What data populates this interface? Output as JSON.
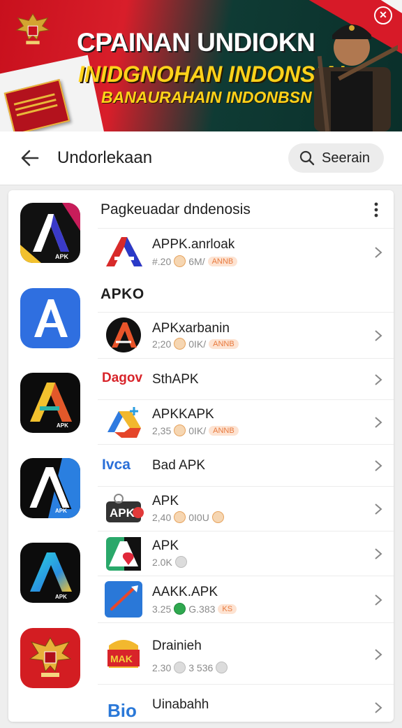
{
  "banner": {
    "line1": "CPAINAN UNDIOKN",
    "line2": "INIDGNOHAN INDONSIA!",
    "line3": "BANAURAHAIN INDONBSN",
    "colors": {
      "red": "#d81e2a",
      "green": "#0f3b34",
      "gold": "#ffd21a"
    }
  },
  "appbar": {
    "title": "Undorlekaan",
    "search_label": "Seerain"
  },
  "sections": [
    {
      "title": "Pagkeuadar dndenosis"
    },
    {
      "title": "APKO"
    }
  ],
  "rows": [
    {
      "title": "APPK.anrloak",
      "version": "#.20",
      "size": "6M/",
      "tag": "ANNB"
    },
    {
      "title": "APKxarbanin",
      "version": "2;20",
      "size": "0IK/",
      "tag": "ANNB"
    },
    {
      "title": "SthAPK",
      "brand": "Dagov"
    },
    {
      "title": "APKKAPK",
      "version": "2,35",
      "size": "0IK/",
      "tag": "ANNB"
    },
    {
      "title": "Bad APK",
      "brand": "Ivca"
    },
    {
      "title": "APK",
      "version": "2,40",
      "size": "0I0U",
      "tag": ""
    },
    {
      "title": "APK",
      "version": "2.0K",
      "size": "",
      "tag": ""
    },
    {
      "title": "AAKK.APK",
      "version": "3.25",
      "size": "G.383",
      "tag": "KS"
    },
    {
      "title": "Drainieh",
      "version": "2.30",
      "size": "3 536",
      "tag": ""
    },
    {
      "title": "Uinabahh",
      "version": "",
      "size": "",
      "tag": ""
    }
  ],
  "icons": {
    "big": [
      "apk-a-black-icon",
      "apk-a-blue-icon",
      "apk-a-yellow-icon",
      "apk-a-white-icon",
      "apk-a-gradient-icon",
      "garuda-icon"
    ],
    "rows": [
      "a-red-icon",
      "a-black-circle-icon",
      "dagov-logo",
      "drive-icon",
      "ivca-logo",
      "apk-badge-icon",
      "map-pin-icon",
      "paper-plane-icon",
      "gmak-logo",
      "bio-logo"
    ]
  }
}
